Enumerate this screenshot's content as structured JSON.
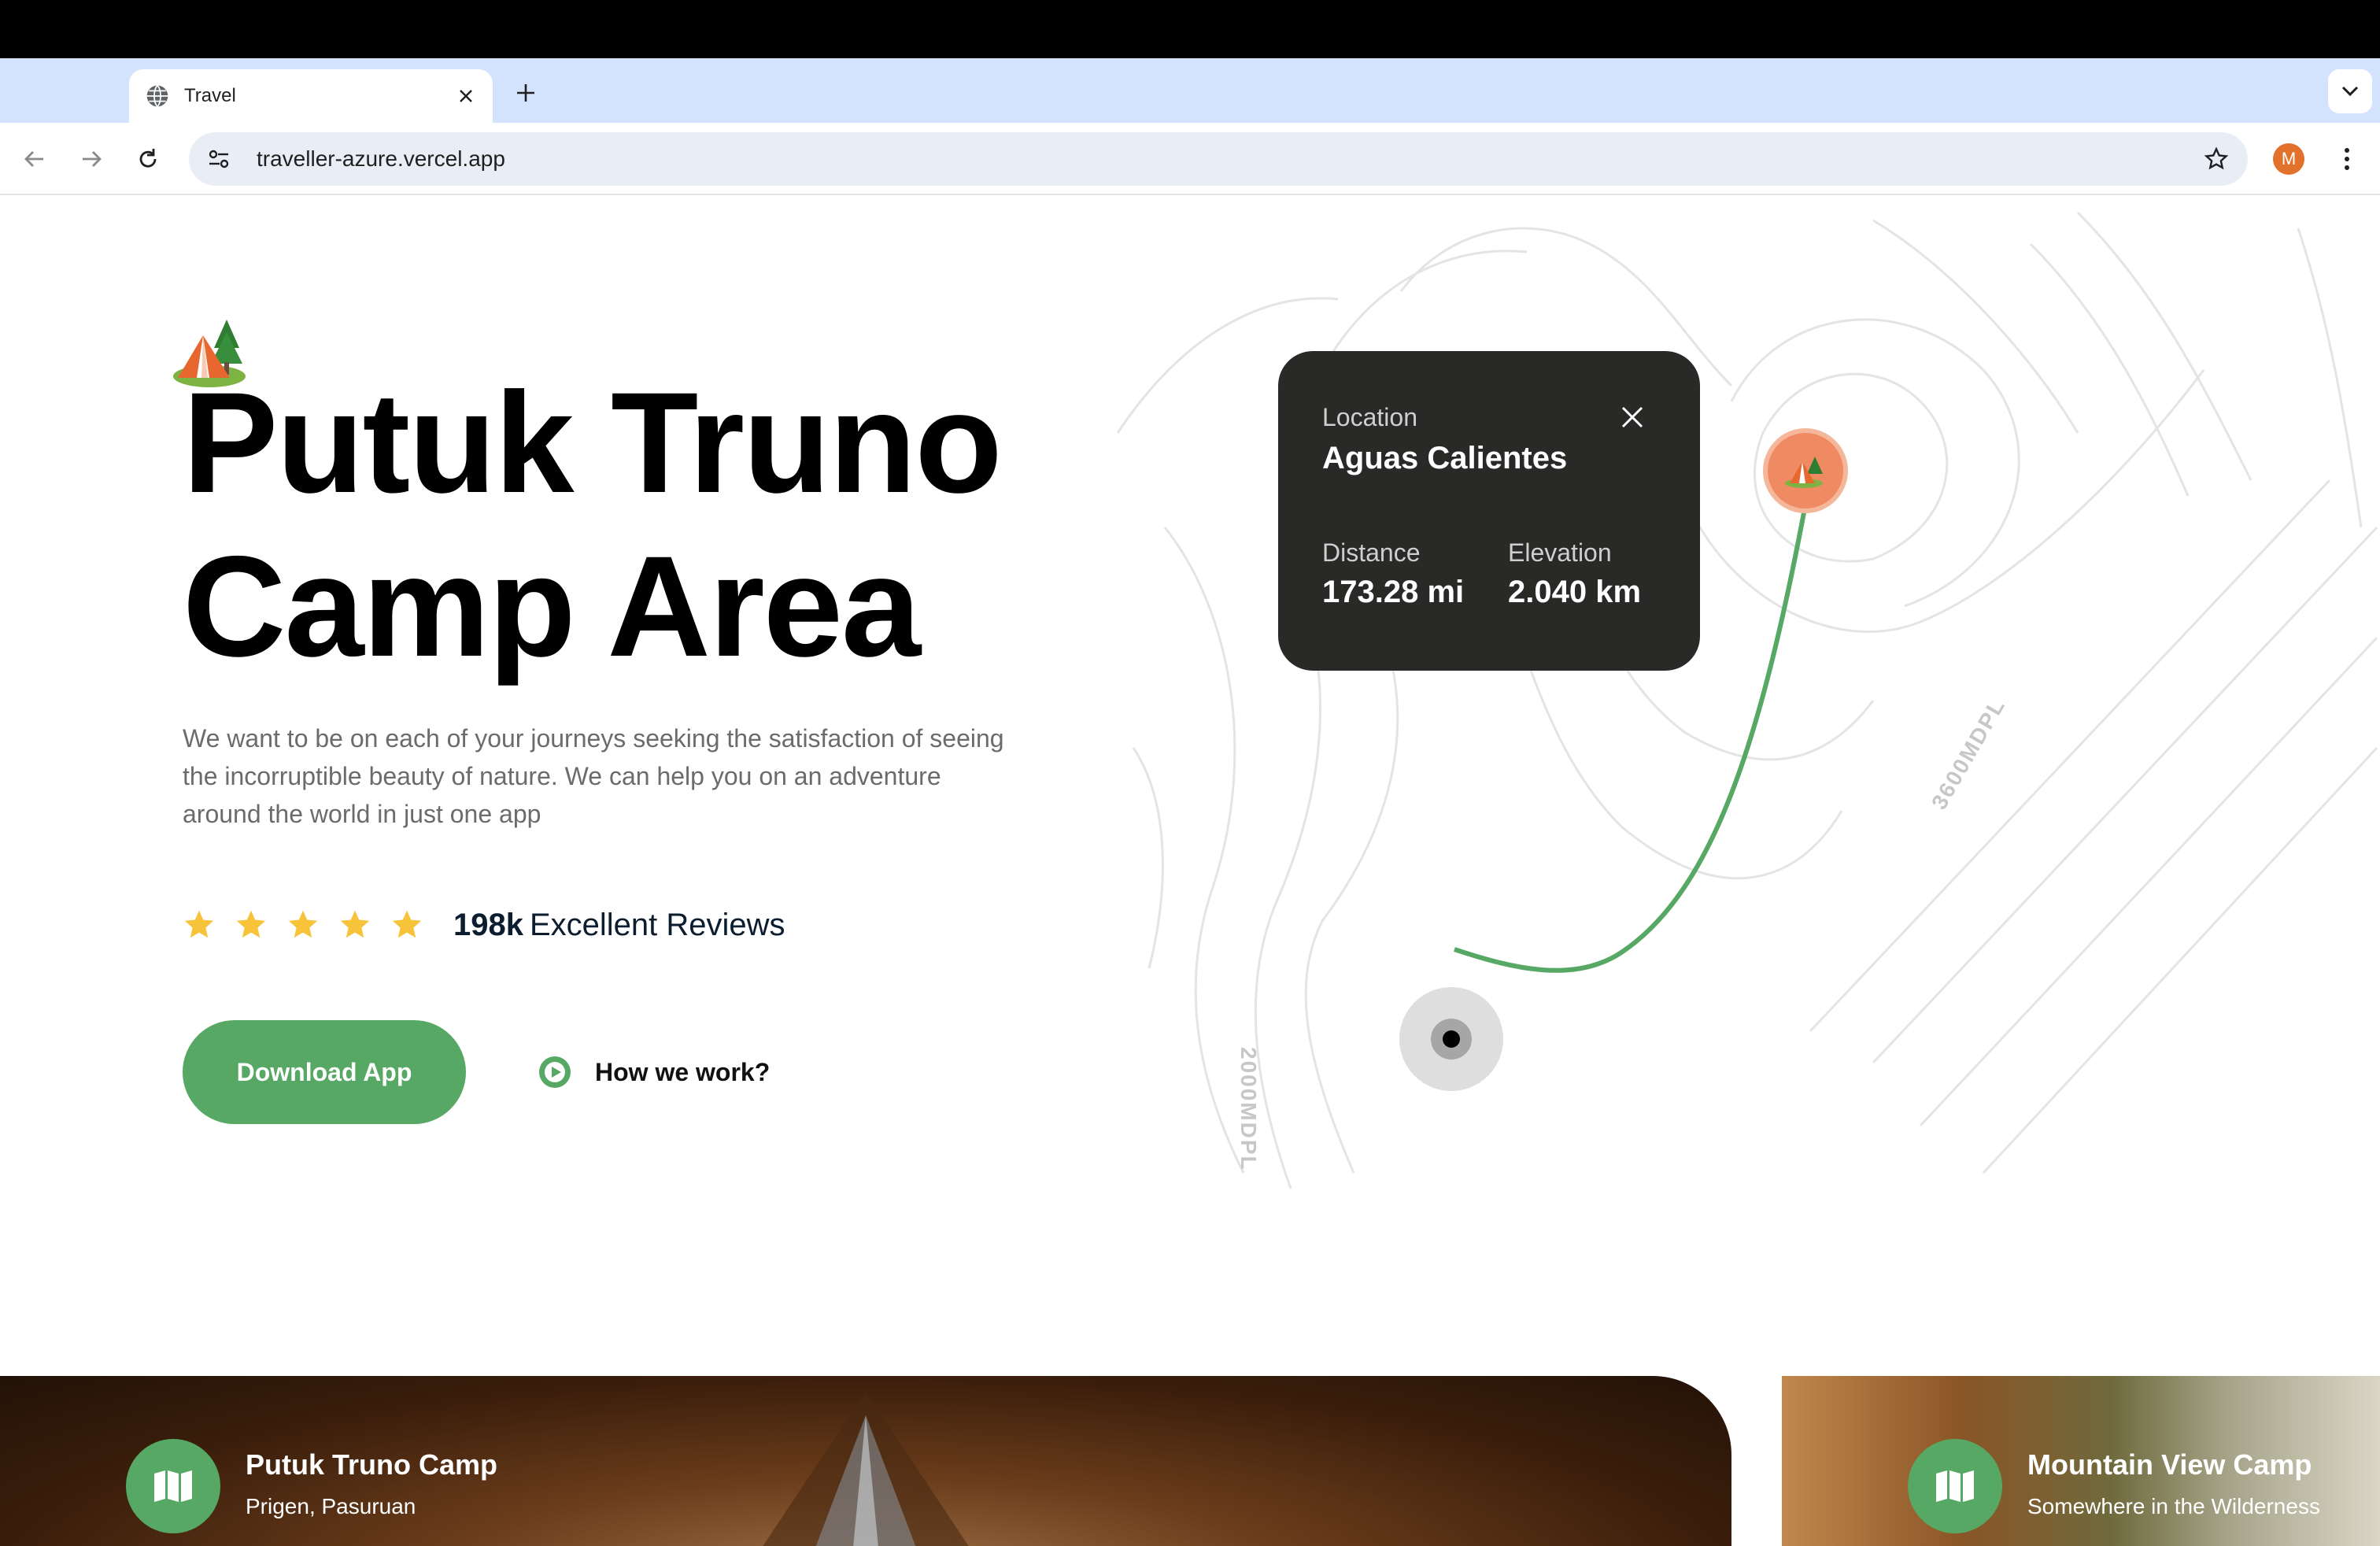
{
  "browser": {
    "tab_title": "Travel",
    "url": "traveller-azure.vercel.app",
    "profile_initial": "M"
  },
  "hero": {
    "title_line1": "Putuk Truno",
    "title_line2": "Camp Area",
    "description": "We want to be on each of your journeys seeking the satisfaction of seeing the incorruptible beauty of nature. We can help you on an adventure around the world in just one app",
    "rating_stars": 5,
    "reviews_count": "198k",
    "reviews_label": "Excellent Reviews",
    "download_button": "Download App",
    "how_link": "How we work?"
  },
  "map_card": {
    "location_label": "Location",
    "location_value": "Aguas Calientes",
    "distance_label": "Distance",
    "distance_value": "173.28 mi",
    "elevation_label": "Elevation",
    "elevation_value": "2.040 km"
  },
  "map": {
    "altitude_labels": [
      "2000MDPL",
      "3600MDPL"
    ]
  },
  "camps": [
    {
      "name": "Putuk Truno Camp",
      "location": "Prigen, Pasuruan"
    },
    {
      "name": "Mountain View Camp",
      "location": "Somewhere in the Wilderness"
    }
  ],
  "colors": {
    "accent_green": "#56a864",
    "card_dark": "#292927",
    "pin_orange": "#f08a62",
    "star_yellow": "#f6c33b"
  }
}
